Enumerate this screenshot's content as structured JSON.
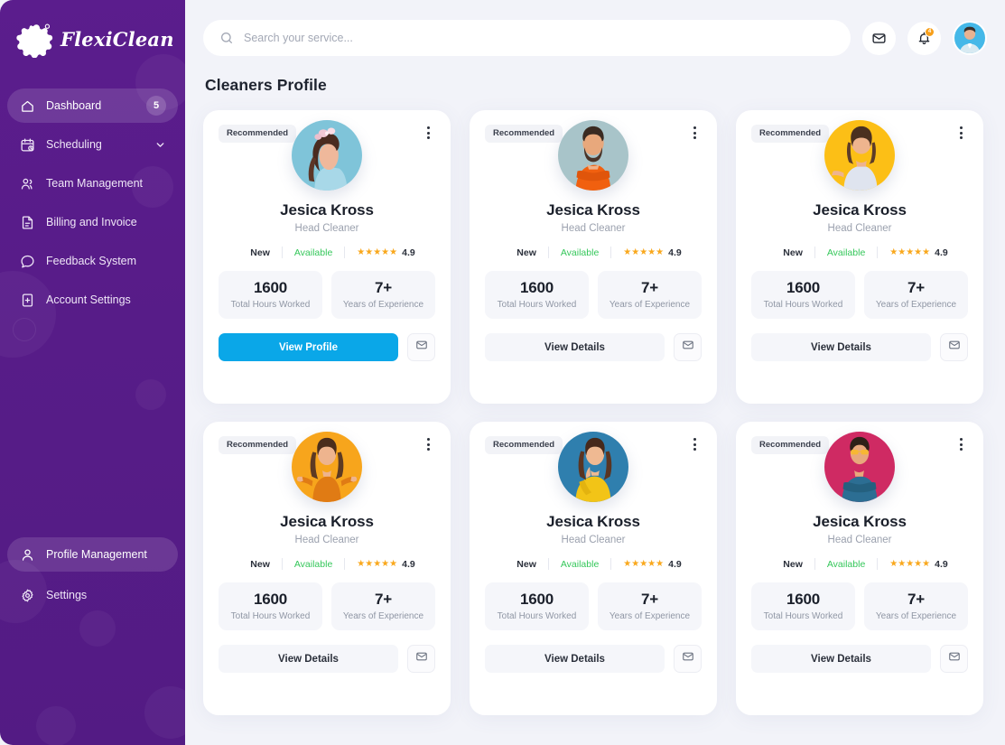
{
  "brand": {
    "name": "FlexiClean",
    "logo_icon": "splat-logo-icon",
    "sidebar_color": "#5c1f8f"
  },
  "sidebar": {
    "items": [
      {
        "label": "Dashboard",
        "icon": "home-icon",
        "badge": "5",
        "active": true
      },
      {
        "label": "Scheduling",
        "icon": "calendar-clock-icon",
        "chevron": "chevron-down-icon",
        "active": false
      },
      {
        "label": "Team Management",
        "icon": "users-icon",
        "active": false
      },
      {
        "label": "Billing and Invoice",
        "icon": "document-lines-icon",
        "active": false
      },
      {
        "label": "Feedback System",
        "icon": "chat-bubble-icon",
        "active": false
      },
      {
        "label": "Account Settings",
        "icon": "document-plus-icon",
        "active": false
      }
    ],
    "bottom_items": [
      {
        "label": "Profile Management",
        "icon": "user-icon",
        "active": true
      },
      {
        "label": "Settings",
        "icon": "gear-icon",
        "active": false
      }
    ]
  },
  "header": {
    "search": {
      "placeholder": "Search your service...",
      "value": "",
      "icon": "search-icon"
    },
    "mail_icon": "envelope-icon",
    "notification_icon": "bell-icon",
    "notification_count": "4",
    "notification_badge_color": "#f79f1a",
    "avatar": "user-avatar"
  },
  "main": {
    "page_title": "Cleaners Profile"
  },
  "labels": {
    "recommended": "Recommended",
    "kebab_icon": "more-vertical-icon",
    "mail_icon": "envelope-icon",
    "new": "New",
    "available": "Available",
    "stat_hours_label": "Total Hours Worked",
    "stat_years_label": "Years of Experience",
    "available_color": "#35c75a",
    "star_color": "#f9a81d",
    "primary_color": "#0aa7e8"
  },
  "cards": [
    {
      "badge": "Recommended",
      "name": "Jesica Kross",
      "role": "Head Cleaner",
      "status_new": "New",
      "status_available": "Available",
      "rating": "4.9",
      "stars": 5,
      "hours": "1600",
      "hours_label": "Total Hours Worked",
      "years": "7+",
      "years_label": "Years of Experience",
      "button": "View Profile",
      "button_style": "primary",
      "avatar_bg": "#7fc4d9",
      "avatar_variant": "woman-flower-crown"
    },
    {
      "badge": "Recommended",
      "name": "Jesica Kross",
      "role": "Head Cleaner",
      "status_new": "New",
      "status_available": "Available",
      "rating": "4.9",
      "stars": 5,
      "hours": "1600",
      "hours_label": "Total Hours Worked",
      "years": "7+",
      "years_label": "Years of Experience",
      "button": "View Details",
      "button_style": "ghost",
      "avatar_bg": "#a8c4c9",
      "avatar_variant": "bearded-man-orange"
    },
    {
      "badge": "Recommended",
      "name": "Jesica Kross",
      "role": "Head Cleaner",
      "status_new": "New",
      "status_available": "Available",
      "rating": "4.9",
      "stars": 5,
      "hours": "1600",
      "hours_label": "Total Hours Worked",
      "years": "7+",
      "years_label": "Years of Experience",
      "button": "View Details",
      "button_style": "ghost",
      "avatar_bg": "#fcbf16",
      "avatar_variant": "woman-pointing-white"
    },
    {
      "badge": "Recommended",
      "name": "Jesica Kross",
      "role": "Head Cleaner",
      "status_new": "New",
      "status_available": "Available",
      "rating": "4.9",
      "stars": 5,
      "hours": "1600",
      "hours_label": "Total Hours Worked",
      "years": "7+",
      "years_label": "Years of Experience",
      "button": "View Details",
      "button_style": "ghost",
      "avatar_bg": "#f7a51c",
      "avatar_variant": "woman-orange-shrug"
    },
    {
      "badge": "Recommended",
      "name": "Jesica Kross",
      "role": "Head Cleaner",
      "status_new": "New",
      "status_available": "Available",
      "rating": "4.9",
      "stars": 5,
      "hours": "1600",
      "hours_label": "Total Hours Worked",
      "years": "7+",
      "years_label": "Years of Experience",
      "button": "View Details",
      "button_style": "ghost",
      "avatar_bg": "#2f7fae",
      "avatar_variant": "woman-yellow-sweater"
    },
    {
      "badge": "Recommended",
      "name": "Jesica Kross",
      "role": "Head Cleaner",
      "status_new": "New",
      "status_available": "Available",
      "rating": "4.9",
      "stars": 5,
      "hours": "1600",
      "hours_label": "Total Hours Worked",
      "years": "7+",
      "years_label": "Years of Experience",
      "button": "View Details",
      "button_style": "ghost",
      "avatar_bg": "#cf2a63",
      "avatar_variant": "man-blue-sweater"
    }
  ]
}
